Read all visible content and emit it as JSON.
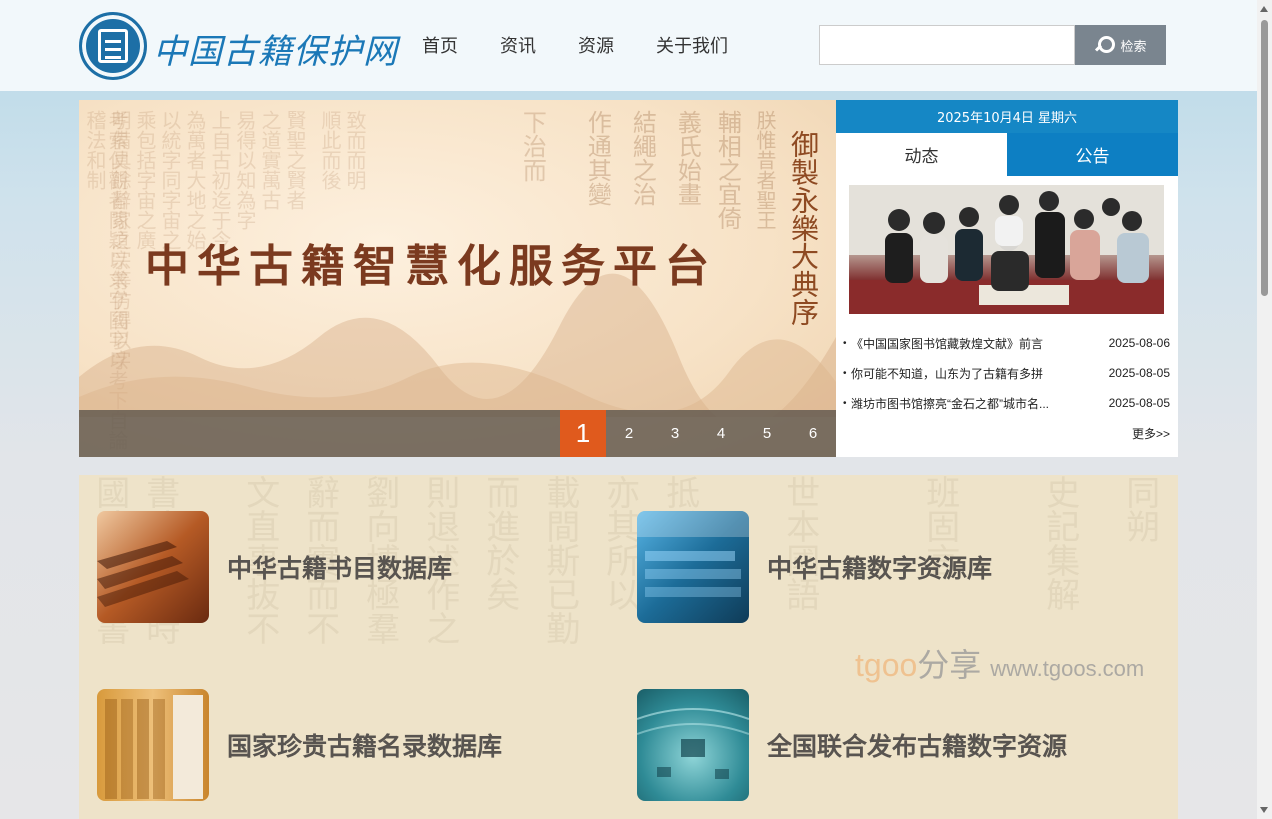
{
  "site": {
    "name": "中国古籍保护网"
  },
  "nav": {
    "items": [
      "首页",
      "资讯",
      "资源",
      "关于我们"
    ]
  },
  "search": {
    "placeholder": "",
    "button_label": "检索"
  },
  "banner": {
    "title": "中华古籍智慧化服务平台",
    "side_title": "御製永樂大典序",
    "pages": [
      "1",
      "2",
      "3",
      "4",
      "5",
      "6"
    ],
    "active_page": "1"
  },
  "news": {
    "date": "2025年10月4日 星期六",
    "tabs": [
      "动态",
      "公告"
    ],
    "items": [
      {
        "title": "《中国国家图书馆藏敦煌文献》前言",
        "date": "2025-08-06"
      },
      {
        "title": "你可能不知道，山东为了古籍有多拼",
        "date": "2025-08-05"
      },
      {
        "title": "潍坊市图书馆擦亮“金石之都”城市名...",
        "date": "2025-08-05"
      }
    ],
    "more_label": "更多>>"
  },
  "databases": [
    {
      "label": "中华古籍书目数据库",
      "thumb_icon": "books-stack-icon"
    },
    {
      "label": "中华古籍数字资源库",
      "thumb_icon": "digital-archive-icon"
    },
    {
      "label": "国家珍贵古籍名录数据库",
      "thumb_icon": "rare-books-icon"
    },
    {
      "label": "全国联合发布古籍数字资源",
      "thumb_icon": "circuit-board-icon"
    }
  ],
  "watermark": {
    "brand": "tgoo",
    "brand_cn": "分享",
    "url": "www.tgoos.com"
  },
  "colors": {
    "accent": "#1587c5",
    "tab_active": "#0d7fc3",
    "pager_active": "#e05a1d",
    "search_button": "#7a858f"
  }
}
